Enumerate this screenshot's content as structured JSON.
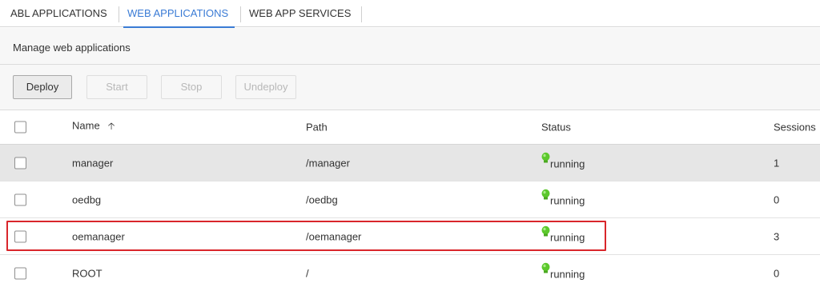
{
  "tabs": [
    {
      "label": "ABL APPLICATIONS",
      "active": false
    },
    {
      "label": "WEB APPLICATIONS",
      "active": true
    },
    {
      "label": "WEB APP SERVICES",
      "active": false
    }
  ],
  "subtitle": "Manage web applications",
  "toolbar": {
    "deploy": "Deploy",
    "start": "Start",
    "stop": "Stop",
    "undeploy": "Undeploy"
  },
  "table": {
    "columns": {
      "name": "Name",
      "path": "Path",
      "status": "Status",
      "sessions": "Sessions"
    },
    "sort": {
      "column": "name",
      "direction": "ascending",
      "icon": "arrow-up-icon"
    },
    "rows": [
      {
        "name": "manager",
        "path": "/manager",
        "status": "running",
        "sessions": "1",
        "selected": true,
        "highlighted": false
      },
      {
        "name": "oedbg",
        "path": "/oedbg",
        "status": "running",
        "sessions": "0",
        "selected": false,
        "highlighted": false
      },
      {
        "name": "oemanager",
        "path": "/oemanager",
        "status": "running",
        "sessions": "3",
        "selected": false,
        "highlighted": true
      },
      {
        "name": "ROOT",
        "path": "/",
        "status": "running",
        "sessions": "0",
        "selected": false,
        "highlighted": false
      }
    ]
  },
  "colors": {
    "active_tab": "#3a7bd5",
    "status_running": "#5cc82c",
    "highlight_border": "#d9262b",
    "selected_row": "#e6e6e6"
  }
}
